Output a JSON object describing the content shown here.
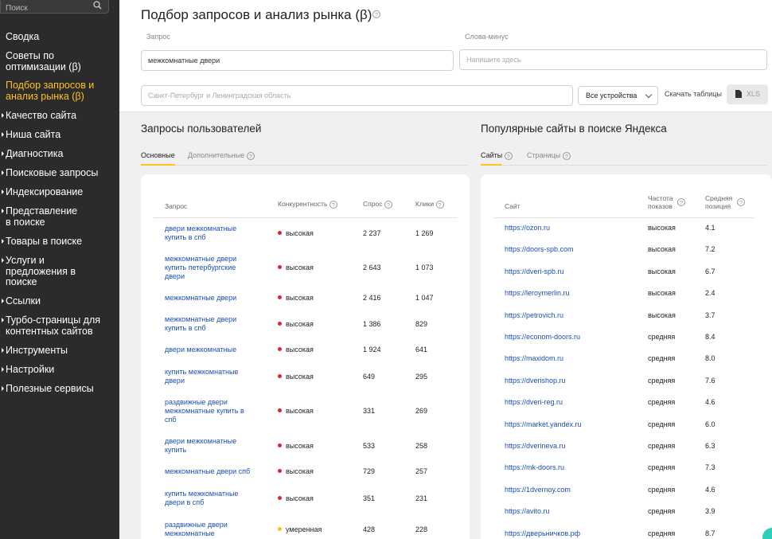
{
  "sidebar": {
    "search_placeholder": "Поиск",
    "items": [
      {
        "label": "Сводка"
      },
      {
        "label": "Советы по оптимизации (β)"
      },
      {
        "label": "Подбор запросов и анализ рынка (β)"
      },
      {
        "label": "Качество сайта"
      },
      {
        "label": "Ниша сайта"
      },
      {
        "label": "Диагностика"
      },
      {
        "label": "Поисковые запросы"
      },
      {
        "label": "Индексирование"
      },
      {
        "label": "Представление в поиске"
      },
      {
        "label": "Товары в поиске"
      },
      {
        "label": "Услуги и предложения в поиске"
      },
      {
        "label": "Ссылки"
      },
      {
        "label": "Турбо-страницы для контентных сайтов"
      },
      {
        "label": "Инструменты"
      },
      {
        "label": "Настройки"
      },
      {
        "label": "Полезные сервисы"
      }
    ]
  },
  "header": {
    "title": "Подбор запросов и анализ рынка (β)",
    "query_label": "Запрос",
    "query_value": "межкомнатные двери",
    "minus_label": "Слова-минус",
    "minus_placeholder": "Напишите здесь",
    "region_placeholder": "Санкт-Петербург и Ленинградская область",
    "devices_value": "Все устройства",
    "download_label": "Скачать таблицы",
    "xls_label": "XLS"
  },
  "queries": {
    "title": "Запросы пользователей",
    "tabs": [
      "Основные",
      "Дополнительные"
    ],
    "columns": [
      "Запрос",
      "Конкурентность",
      "Спрос",
      "Клики"
    ],
    "rows": [
      {
        "query": "двери межкомнатные купить в спб",
        "competition": "высокая",
        "level": "high",
        "demand": "2 237",
        "clicks": "1 269"
      },
      {
        "query": "межкомнатные двери купить петербургские двери",
        "competition": "высокая",
        "level": "high",
        "demand": "2 643",
        "clicks": "1 073"
      },
      {
        "query": "межкомнатные двери",
        "competition": "высокая",
        "level": "high",
        "demand": "2 416",
        "clicks": "1 047"
      },
      {
        "query": "межкомнатные двери купить в спб",
        "competition": "высокая",
        "level": "high",
        "demand": "1 386",
        "clicks": "829"
      },
      {
        "query": "двери межкомнатные",
        "competition": "высокая",
        "level": "high",
        "demand": "1 924",
        "clicks": "641"
      },
      {
        "query": "купить межкомнатные двери",
        "competition": "высокая",
        "level": "high",
        "demand": "649",
        "clicks": "295"
      },
      {
        "query": "раздвижные двери межкомнатные купить в спб",
        "competition": "высокая",
        "level": "high",
        "demand": "331",
        "clicks": "269"
      },
      {
        "query": "двери межкомнатные купить",
        "competition": "высокая",
        "level": "high",
        "demand": "533",
        "clicks": "258"
      },
      {
        "query": "межкомнатные двери спб",
        "competition": "высокая",
        "level": "high",
        "demand": "729",
        "clicks": "257"
      },
      {
        "query": "купить межкомнатные двери в спб",
        "competition": "высокая",
        "level": "high",
        "demand": "351",
        "clicks": "231"
      },
      {
        "query": "раздвижные двери межкомнатные",
        "competition": "умеренная",
        "level": "medium",
        "demand": "428",
        "clicks": "228"
      }
    ]
  },
  "sites": {
    "title": "Популярные сайты в поиске Яндекса",
    "tabs": [
      "Сайты",
      "Страницы"
    ],
    "columns": [
      "Сайт",
      "Частота показов",
      "Средняя позиция"
    ],
    "rows": [
      {
        "site": "https://ozon.ru",
        "freq": "высокая",
        "pos": "4.1"
      },
      {
        "site": "https://doors-spb.com",
        "freq": "высокая",
        "pos": "7.2"
      },
      {
        "site": "https://dveri-spb.ru",
        "freq": "высокая",
        "pos": "6.7"
      },
      {
        "site": "https://leroymerlin.ru",
        "freq": "высокая",
        "pos": "2.4"
      },
      {
        "site": "https://petrovich.ru",
        "freq": "высокая",
        "pos": "3.7"
      },
      {
        "site": "https://econom-doors.ru",
        "freq": "средняя",
        "pos": "8.4"
      },
      {
        "site": "https://maxidom.ru",
        "freq": "средняя",
        "pos": "8.0"
      },
      {
        "site": "https://dverishop.ru",
        "freq": "средняя",
        "pos": "7.6"
      },
      {
        "site": "https://dveri-reg.ru",
        "freq": "средняя",
        "pos": "4.6"
      },
      {
        "site": "https://market.yandex.ru",
        "freq": "средняя",
        "pos": "6.0"
      },
      {
        "site": "https://dverineva.ru",
        "freq": "средняя",
        "pos": "6.3"
      },
      {
        "site": "https://mk-doors.ru",
        "freq": "средняя",
        "pos": "7.3"
      },
      {
        "site": "https://1dvernoy.com",
        "freq": "средняя",
        "pos": "4.6"
      },
      {
        "site": "https://avito.ru",
        "freq": "средняя",
        "pos": "3.9"
      },
      {
        "site": "https://дверьничков.рф",
        "freq": "средняя",
        "pos": "8.7"
      }
    ]
  },
  "colors": {
    "accent": "#ffc21f",
    "link": "#1a4fb8",
    "high": "#e0262d",
    "medium": "#f5c518",
    "sidebar": "#2b2b2b"
  }
}
